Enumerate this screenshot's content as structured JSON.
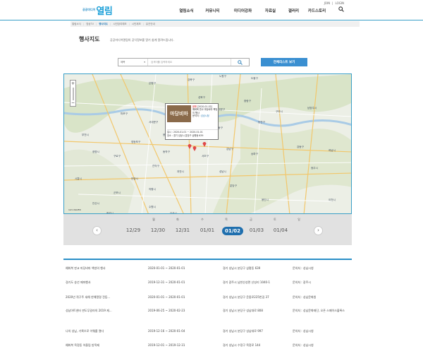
{
  "header": {
    "util_links": [
      "JOIN",
      "LOGIN"
    ],
    "logo_small": "공공미디어",
    "logo_big": "열림",
    "nav": [
      "열림소식",
      "커뮤니티",
      "미디어강좌",
      "자료실",
      "갤러리",
      "카드스토리"
    ],
    "search_icon": "search-icon"
  },
  "breadcrumb": [
    "열림소식",
    "영상TV",
    "행사지도",
    "시민참여예보",
    "시민제보",
    "유관안내"
  ],
  "breadcrumb_active_index": 2,
  "page": {
    "title": "행사지도",
    "description": "공공미디어열림의 공익정보를 알기 쉽게 알려드립니다."
  },
  "search": {
    "category": "제목",
    "placeholder": "검색어를 입력하세요",
    "all_events_button": "전체리스트 보기"
  },
  "map": {
    "zoom_in": "+",
    "zoom_out": "−",
    "scale_text": "1km  NAVER",
    "labels": [
      "은평구",
      "강북구",
      "노원구",
      "도봉구",
      "성북구",
      "중랑구",
      "구리시",
      "남양주시",
      "마포구",
      "종로구",
      "동대문구",
      "광진구",
      "중구",
      "성동구",
      "서대문구",
      "용산구",
      "강동구",
      "하남시",
      "부천시",
      "영등포구",
      "동작구",
      "서초구",
      "강남구",
      "송파구",
      "광명시",
      "구로구",
      "관악구",
      "과천시",
      "성남시",
      "광주시",
      "시흥시",
      "안양시",
      "의왕시",
      "분당구",
      "군포시",
      "안산시",
      "수원시",
      "용인시",
      "이천시",
      "화성시",
      "오산시"
    ],
    "popup": {
      "badge": "문화",
      "dates_head": "[2020-01-02]",
      "title": "예화북 판교 마당비마 책방의 행사",
      "org_label": "문의처",
      "org_value": "성남시청",
      "image_text": "마당비마",
      "period": "일시 : 2020-01-01 ~ 2020-01-01",
      "place": "장소 : 경기 성남시 분당구 삼평동 639"
    }
  },
  "week": {
    "days": [
      "월",
      "화",
      "수",
      "목",
      "금",
      "토",
      "일"
    ],
    "dates": [
      "12/29",
      "12/30",
      "12/31",
      "01/01",
      "01/02",
      "01/03",
      "01/04"
    ],
    "selected_index": 4,
    "prev": "‹",
    "next": "›"
  },
  "events": [
    {
      "title": "예화북 판교 마당비마 책방의 행사",
      "period": "2020-01-01 ~ 2020-01-01",
      "place": "경기 성남시 분당구 삼평동 639",
      "contact": "문의처 : 성남시청"
    },
    {
      "title": "경기도 송년 페마행사",
      "period": "2019-12-31 ~ 2020-01-01",
      "place": "경기 광주시 남한산성면 산성리 1040-1",
      "contact": "문의처 : 광주시"
    },
    {
      "title": "2020년 쥐구주 새해 한해맹명 전등...",
      "period": "2020-01-01 ~ 2020-01-01",
      "place": "경기 성남시 분당구 운중로225번길 37",
      "contact": "문의처 : 성남문화원"
    },
    {
      "title": "성남아트센터 판도무갈라의 2019 제...",
      "period": "2019-06-25 ~ 2020-02-23",
      "place": "경기 성남시 분당구 성남대로 808",
      "contact": "문의처 : 성남문화재단, 오픈 스페이스블록스"
    },
    {
      "title": "나의 성남, 기록으로 이웨를 열다",
      "period": "2019-12-16 ~ 2020-01-04",
      "place": "경기 성남시 분당구 성남대로 997",
      "contact": "문의처 : 성남시청"
    },
    {
      "title": "예화북 목정동 어울림 방목제",
      "period": "2019-12-01 ~ 2019-12-31",
      "place": "경기 성남시 수정구 목정로 144",
      "contact": "문의처 : 성남시청"
    }
  ],
  "colors": {
    "accent": "#2a8fc7",
    "button": "#3a8fd1",
    "selected_date": "#1f6fae",
    "marker": "#e04848"
  }
}
